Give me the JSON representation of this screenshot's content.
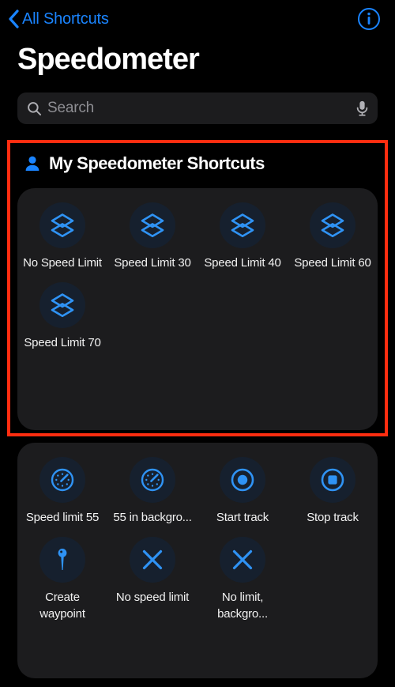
{
  "nav": {
    "back_label": "All Shortcuts",
    "back_icon": "chevron-left-icon",
    "info_icon": "info-circle-icon"
  },
  "header": {
    "title": "Speedometer"
  },
  "search": {
    "placeholder": "Search",
    "value": "",
    "icon": "search-icon",
    "mic_icon": "microphone-icon"
  },
  "colors": {
    "accent_blue": "#1a84ff",
    "icon_blue": "#2f93f5",
    "highlight_red": "#ff2d10",
    "card_background": "#1c1c1e",
    "icon_circle_background": "#16202e",
    "page_background": "#000000",
    "placeholder_grey": "#8e8e93"
  },
  "my_shortcuts_section": {
    "icon": "person-icon",
    "title": "My Speedometer Shortcuts",
    "highlighted": true,
    "items": [
      {
        "label": "No Speed Limit",
        "icon": "square-stack-icon"
      },
      {
        "label": "Speed Limit 30",
        "icon": "square-stack-icon"
      },
      {
        "label": "Speed Limit 40",
        "icon": "square-stack-icon"
      },
      {
        "label": "Speed Limit 60",
        "icon": "square-stack-icon"
      },
      {
        "label": "Speed Limit 70",
        "icon": "square-stack-icon"
      }
    ]
  },
  "gallery_section": {
    "items": [
      {
        "label": "Speed limit 55",
        "icon": "gauge-icon"
      },
      {
        "label": "55 in backgro...",
        "icon": "gauge-icon"
      },
      {
        "label": "Start track",
        "icon": "record-circle-icon"
      },
      {
        "label": "Stop track",
        "icon": "stop-circle-icon"
      },
      {
        "label": "Create waypoint",
        "icon": "map-pin-icon"
      },
      {
        "label": "No speed limit",
        "icon": "xmark-icon"
      },
      {
        "label": "No limit, backgro...",
        "icon": "xmark-icon"
      }
    ]
  }
}
